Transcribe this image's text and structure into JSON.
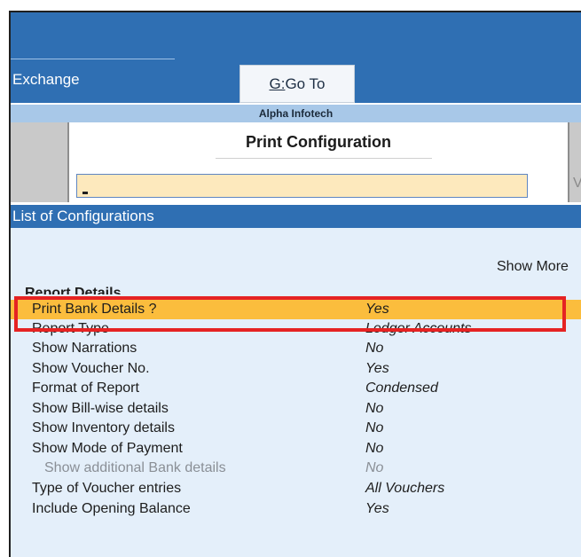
{
  "menu": {
    "exchange_label": "Exchange",
    "goto_key": "G:",
    "goto_label": "Go To"
  },
  "company": {
    "name": "Alpha Infotech"
  },
  "dialog": {
    "title": "Print Configuration",
    "input_value": ""
  },
  "list": {
    "header": "List of Configurations",
    "show_more": "Show More",
    "section": "Report Details",
    "rows": [
      {
        "label": "Print Bank Details ?",
        "value": "Yes"
      },
      {
        "label": "Report Type",
        "value": "Ledger Accounts"
      },
      {
        "label": "Show Narrations",
        "value": "No"
      },
      {
        "label": "Show Voucher No.",
        "value": "Yes"
      },
      {
        "label": "Format of Report",
        "value": "Condensed"
      },
      {
        "label": "Show Bill-wise details",
        "value": "No"
      },
      {
        "label": "Show Inventory details",
        "value": "No"
      },
      {
        "label": "Show Mode of Payment",
        "value": "No"
      },
      {
        "label": "Show additional Bank details",
        "value": "No"
      },
      {
        "label": "Type of Voucher entries",
        "value": "All Vouchers"
      },
      {
        "label": "Include Opening Balance",
        "value": "Yes"
      }
    ]
  },
  "colors": {
    "accent": "#2f6fb3",
    "selected_row": "#fbbd3d",
    "highlight_border": "#e52323",
    "list_background": "#e4effa"
  }
}
